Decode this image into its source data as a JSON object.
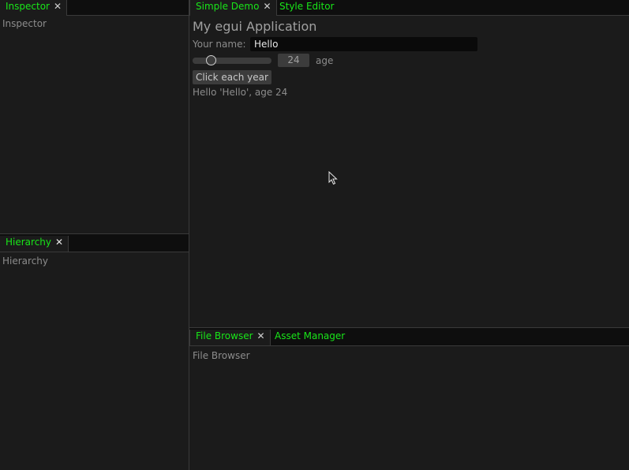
{
  "inspector": {
    "tab_label": "Inspector",
    "close_glyph": "✕",
    "body_text": "Inspector"
  },
  "hierarchy": {
    "tab_label": "Hierarchy",
    "close_glyph": "✕",
    "body_text": "Hierarchy"
  },
  "center": {
    "tabs": [
      {
        "label": "Simple Demo",
        "close_glyph": "✕",
        "active": true
      },
      {
        "label": "Style Editor",
        "active": false
      }
    ],
    "heading": "My egui Application",
    "name_label": "Your name:",
    "name_value": "Hello",
    "age_value": "24",
    "age_slider_fraction": 0.24,
    "age_label": "age",
    "button_label": "Click each year",
    "greeting": "Hello 'Hello', age 24"
  },
  "bottom": {
    "tabs": [
      {
        "label": "File Browser",
        "close_glyph": "✕",
        "active": true
      },
      {
        "label": "Asset Manager",
        "active": false
      }
    ],
    "body_text": "File Browser"
  },
  "colors": {
    "background": "#1b1b1b",
    "tab_text": "#19e619",
    "text": "#8c8c8c",
    "widget": "#3c3c3c"
  },
  "icons": {
    "tab_close": "close-icon",
    "mouse_cursor": "cursor-icon"
  }
}
